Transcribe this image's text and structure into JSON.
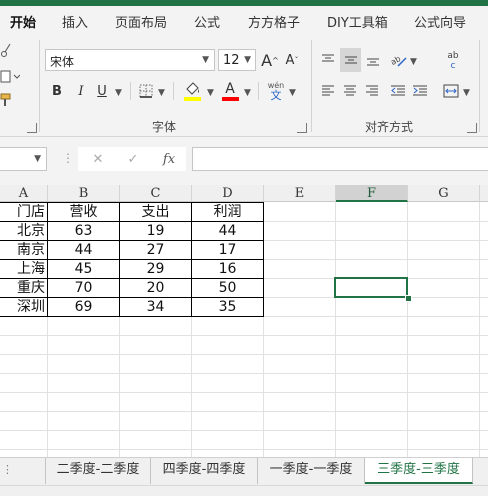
{
  "ribbon_tabs": [
    "开始",
    "插入",
    "页面布局",
    "公式",
    "方方格子",
    "DIY工具箱",
    "公式向导"
  ],
  "font": {
    "name": "宋体",
    "size": "12",
    "bold": "B",
    "italic": "I",
    "underline": "U",
    "group_label": "字体",
    "wen_top": "wén",
    "wen_bottom": "文",
    "grow": "A",
    "shrink": "A",
    "font_color_letter": "A"
  },
  "alignment": {
    "group_label": "对齐方式",
    "wrap_text": "ab c",
    "wrap_text_top": "ab",
    "wrap_text_bottom": "c"
  },
  "formula_bar": {
    "cancel": "✕",
    "enter": "✓",
    "fx": "fx",
    "value": ""
  },
  "columns": [
    "A",
    "B",
    "C",
    "D",
    "E",
    "F",
    "G"
  ],
  "selected_column": "F",
  "table": {
    "headers": [
      "门店",
      "营收",
      "支出",
      "利润"
    ],
    "rows": [
      [
        "北京",
        "63",
        "19",
        "44"
      ],
      [
        "南京",
        "44",
        "27",
        "17"
      ],
      [
        "上海",
        "45",
        "29",
        "16"
      ],
      [
        "重庆",
        "70",
        "20",
        "50"
      ],
      [
        "深圳",
        "69",
        "34",
        "35"
      ]
    ]
  },
  "sheet_tabs": [
    "二季度-二季度",
    "四季度-四季度",
    "一季度-一季度",
    "三季度-三季度"
  ],
  "active_sheet": "三季度-三季度",
  "colors": {
    "accent": "#217346",
    "highlight_bar": "#ffff00",
    "font_color_bar": "#ff0000"
  }
}
